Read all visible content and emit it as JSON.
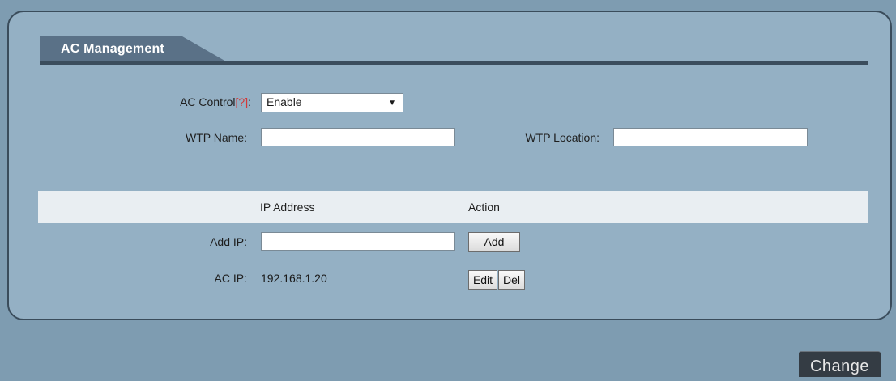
{
  "section": {
    "title": "AC Management"
  },
  "form": {
    "ac_control": {
      "label": "AC Control",
      "help": "[?]",
      "colon": ":",
      "value": "Enable"
    },
    "wtp_name": {
      "label": "WTP Name:",
      "value": ""
    },
    "wtp_location": {
      "label": "WTP Location:",
      "value": ""
    }
  },
  "table": {
    "headers": [
      "IP Address",
      "Action"
    ],
    "add_row": {
      "label": "Add IP:",
      "value": "",
      "button": "Add"
    },
    "ac_row": {
      "label": "AC IP:",
      "ip": "192.168.1.20",
      "edit": "Edit",
      "del": "Del"
    }
  },
  "footer": {
    "change_label": "Change"
  },
  "colors": {
    "background": "#7e9cb1",
    "panel": "#94b0c4",
    "tab": "#5a7187",
    "help": "#d43838",
    "change_button": "#343c44"
  }
}
